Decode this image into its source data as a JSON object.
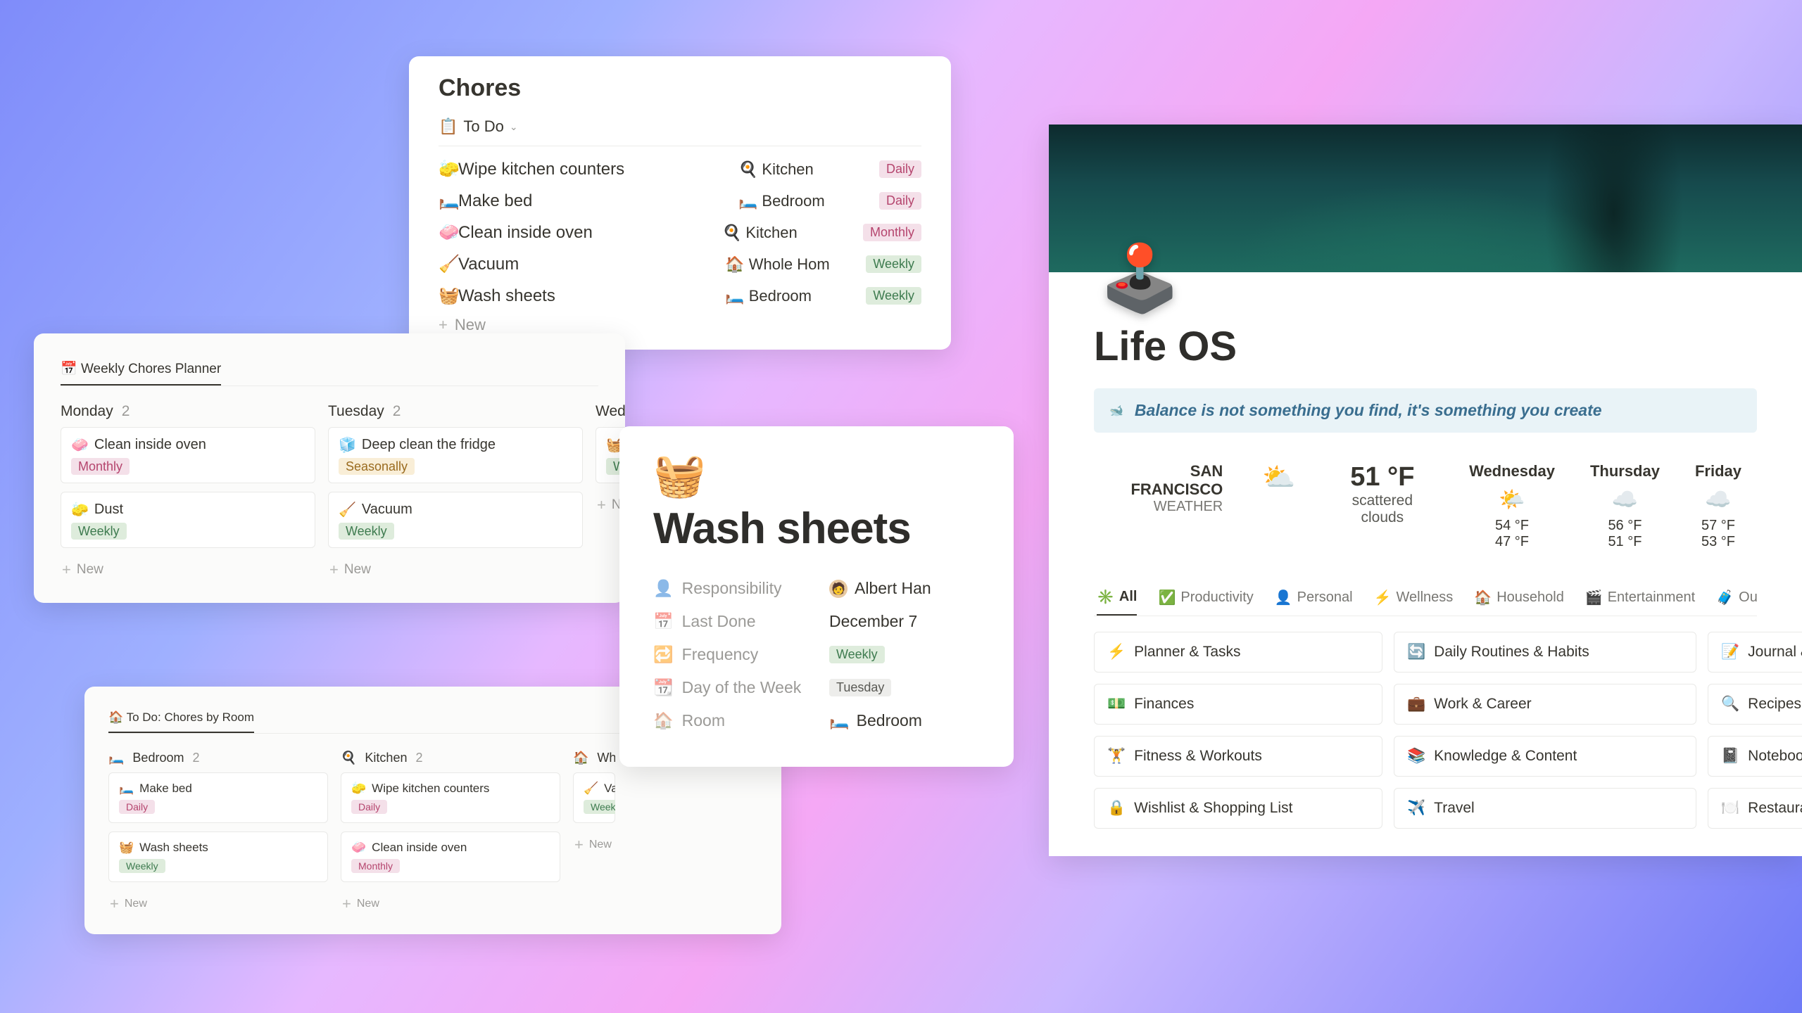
{
  "chores_card": {
    "title": "Chores",
    "view_label": "To Do",
    "new_label": "New",
    "rows": [
      {
        "icon": "🧽",
        "name": "Wipe kitchen counters",
        "room_icon": "🍳",
        "room": "Kitchen",
        "freq": "Daily",
        "freq_class": "daily"
      },
      {
        "icon": "🛏️",
        "name": "Make bed",
        "room_icon": "🛏️",
        "room": "Bedroom",
        "freq": "Daily",
        "freq_class": "daily"
      },
      {
        "icon": "🧼",
        "name": "Clean inside oven",
        "room_icon": "🍳",
        "room": "Kitchen",
        "freq": "Monthly",
        "freq_class": "monthly"
      },
      {
        "icon": "🧹",
        "name": "Vacuum",
        "room_icon": "🏠",
        "room": "Whole Hom",
        "freq": "Weekly",
        "freq_class": "weekly"
      },
      {
        "icon": "🧺",
        "name": "Wash sheets",
        "room_icon": "🛏️",
        "room": "Bedroom",
        "freq": "Weekly",
        "freq_class": "weekly"
      }
    ]
  },
  "planner": {
    "tab_icon": "📅",
    "tab_label": "Weekly Chores Planner",
    "new_label": "New",
    "columns": [
      {
        "day": "Monday",
        "count": "2",
        "cards": [
          {
            "icon": "🧼",
            "title": "Clean inside oven",
            "freq": "Monthly",
            "freq_class": "monthly"
          },
          {
            "icon": "🧽",
            "title": "Dust",
            "freq": "Weekly",
            "freq_class": "weekly"
          }
        ]
      },
      {
        "day": "Tuesday",
        "count": "2",
        "cards": [
          {
            "icon": "🧊",
            "title": "Deep clean the fridge",
            "freq": "Seasonally",
            "freq_class": "seasonally"
          },
          {
            "icon": "🧹",
            "title": "Vacuum",
            "freq": "Weekly",
            "freq_class": "weekly"
          }
        ]
      },
      {
        "day": "Wed",
        "count": "",
        "cards": [
          {
            "icon": "🧺",
            "title": "",
            "freq": "We",
            "freq_class": "weekly"
          }
        ]
      }
    ]
  },
  "room_board": {
    "tab_icon": "🏠",
    "tab_label": "To Do: Chores by Room",
    "new_label": "New",
    "columns": [
      {
        "icon": "🛏️",
        "name": "Bedroom",
        "count": "2",
        "cards": [
          {
            "icon": "🛏️",
            "title": "Make bed",
            "freq": "Daily",
            "freq_class": "daily"
          },
          {
            "icon": "🧺",
            "title": "Wash sheets",
            "freq": "Weekly",
            "freq_class": "weekly"
          }
        ]
      },
      {
        "icon": "🍳",
        "name": "Kitchen",
        "count": "2",
        "cards": [
          {
            "icon": "🧽",
            "title": "Wipe kitchen counters",
            "freq": "Daily",
            "freq_class": "daily"
          },
          {
            "icon": "🧼",
            "title": "Clean inside oven",
            "freq": "Monthly",
            "freq_class": "monthly"
          }
        ]
      },
      {
        "icon": "🏠",
        "name": "Who",
        "count": "",
        "cards": [
          {
            "icon": "🧹",
            "title": "Vac",
            "freq": "Weekly",
            "freq_class": "weekly"
          }
        ]
      }
    ]
  },
  "detail": {
    "icon": "🧺",
    "title": "Wash sheets",
    "props": [
      {
        "icon": "👤",
        "label": "Responsibility",
        "value": "Albert Han",
        "avatar": "🧑"
      },
      {
        "icon": "📅",
        "label": "Last Done",
        "value": "December 7"
      },
      {
        "icon": "🔁",
        "label": "Frequency",
        "value": "Weekly",
        "pill": "weekly"
      },
      {
        "icon": "📆",
        "label": "Day of the Week",
        "value": "Tuesday",
        "pill": "day"
      },
      {
        "icon": "🏠",
        "label": "Room",
        "value": "Bedroom",
        "room_icon": "🛏️"
      }
    ]
  },
  "lifeos": {
    "emoji": "🕹️",
    "title": "Life OS",
    "quote_icon": "🐋",
    "quote": "Balance is not something you find, it's something you create",
    "weather": {
      "city": "SAN FRANCISCO",
      "sub": "WEATHER",
      "now_icon": "⛅",
      "now_temp": "51 °F",
      "now_cond": "scattered clouds",
      "days": [
        {
          "name": "Wednesday",
          "icon": "🌤️",
          "hi": "54 °F",
          "lo": "47 °F"
        },
        {
          "name": "Thursday",
          "icon": "☁️",
          "hi": "56 °F",
          "lo": "51 °F"
        },
        {
          "name": "Friday",
          "icon": "☁️",
          "hi": "57 °F",
          "lo": "53 °F"
        }
      ]
    },
    "tabs": [
      {
        "icon": "✳️",
        "label": "All",
        "active": true
      },
      {
        "icon": "✅",
        "label": "Productivity"
      },
      {
        "icon": "👤",
        "label": "Personal"
      },
      {
        "icon": "⚡",
        "label": "Wellness"
      },
      {
        "icon": "🏠",
        "label": "Household"
      },
      {
        "icon": "🎬",
        "label": "Entertainment"
      },
      {
        "icon": "🧳",
        "label": "Out & About"
      }
    ],
    "links": [
      {
        "icon": "⚡",
        "label": "Planner & Tasks"
      },
      {
        "icon": "🔄",
        "label": "Daily Routines & Habits"
      },
      {
        "icon": "📝",
        "label": "Journal &"
      },
      {
        "icon": "💵",
        "label": "Finances"
      },
      {
        "icon": "💼",
        "label": "Work & Career"
      },
      {
        "icon": "🔍",
        "label": "Recipes &"
      },
      {
        "icon": "🏋️",
        "label": "Fitness & Workouts"
      },
      {
        "icon": "📚",
        "label": "Knowledge & Content"
      },
      {
        "icon": "📓",
        "label": "Notebook"
      },
      {
        "icon": "🔒",
        "label": "Wishlist & Shopping List"
      },
      {
        "icon": "✈️",
        "label": "Travel"
      },
      {
        "icon": "🍽️",
        "label": "Restauran"
      }
    ]
  }
}
